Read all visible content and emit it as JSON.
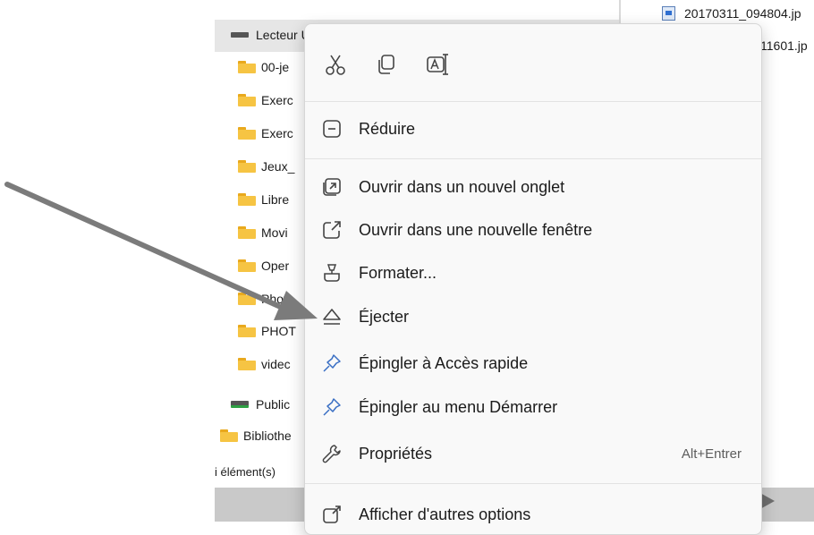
{
  "nav_tree": {
    "selected_drive": "Lecteur USB (D:)",
    "folders": [
      "00-je",
      "Exerc",
      "Exerc",
      "Jeux_",
      "Libre",
      "Movi",
      "Oper",
      "Photo",
      "PHOT",
      "videc"
    ],
    "public_drive": "Public",
    "library": "Bibliothe"
  },
  "file_list": {
    "files": [
      "20170311_094804.jp",
      "11601.jp"
    ]
  },
  "status_bar": {
    "count_text": "i élément(s)"
  },
  "context_menu": {
    "quick_actions": [
      {
        "name": "cut",
        "icon": "scissors-icon"
      },
      {
        "name": "copy",
        "icon": "copy-icon"
      },
      {
        "name": "rename",
        "icon": "rename-icon"
      }
    ],
    "items": [
      {
        "label": "Réduire",
        "icon": "collapse-icon"
      },
      {
        "label": "Ouvrir dans un nouvel onglet",
        "icon": "new-tab-icon"
      },
      {
        "label": "Ouvrir dans une nouvelle fenêtre",
        "icon": "new-window-icon"
      },
      {
        "label": "Formater...",
        "icon": "format-icon"
      },
      {
        "label": "Éjecter",
        "icon": "eject-icon"
      },
      {
        "label": "Épingler à Accès rapide",
        "icon": "pin-icon"
      },
      {
        "label": "Épingler au menu Démarrer",
        "icon": "pin-icon"
      },
      {
        "label": "Propriétés",
        "icon": "wrench-icon",
        "accelerator": "Alt+Entrer"
      },
      {
        "label": "Afficher d'autres options",
        "icon": "more-options-icon"
      }
    ]
  },
  "colors": {
    "accent": "#0067c0",
    "folder": "#f6c443",
    "arrow": "#7b7b7b"
  }
}
